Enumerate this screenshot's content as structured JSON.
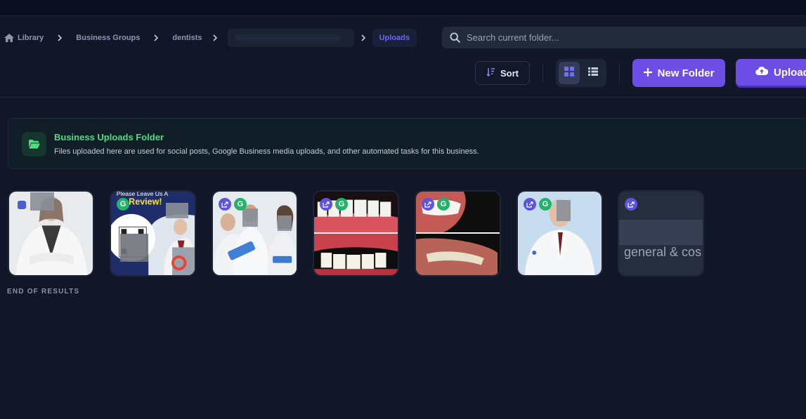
{
  "breadcrumb": {
    "items": [
      {
        "label": "Library"
      },
      {
        "label": "Business Groups"
      },
      {
        "label": "dentists"
      },
      {
        "label": ""
      }
    ],
    "current": "Uploads"
  },
  "search": {
    "placeholder": "Search current folder..."
  },
  "toolbar": {
    "sort_label": "Sort",
    "view_mode": "grid",
    "new_folder_label": "New Folder",
    "upload_label": "Upload"
  },
  "banner": {
    "title": "Business Uploads Folder",
    "text": "Files uploaded here are used for social posts, Google Business media uploads, and other automated tasks for this business."
  },
  "tiles": [
    {
      "badges": [
        "calendar"
      ]
    },
    {
      "badges": [
        "google"
      ],
      "overlay_text": "Please Leave Us A Review!"
    },
    {
      "badges": [
        "share",
        "google"
      ]
    },
    {
      "badges": [
        "share",
        "google"
      ]
    },
    {
      "badges": [
        "share",
        "google"
      ]
    },
    {
      "badges": [
        "share",
        "google"
      ]
    },
    {
      "badges": [
        "share"
      ],
      "overlay_text": "general & cos"
    }
  ],
  "footer": {
    "end_label": "END OF RESULTS"
  },
  "colors": {
    "background": "#111729",
    "accent": "#6c4ee6",
    "banner_title": "#4ade80",
    "active_crumb": "#6d63f0"
  }
}
